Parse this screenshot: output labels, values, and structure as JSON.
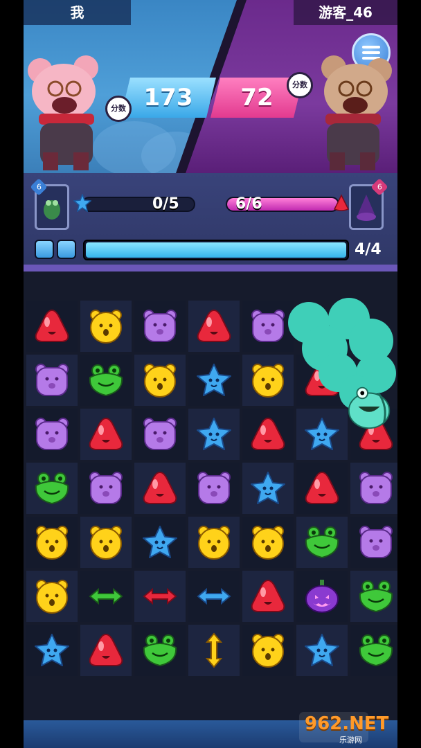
{
  "header": {
    "player_left_name": "我",
    "player_right_name": "游客_46",
    "score_left": "173",
    "score_right": "72",
    "score_badge_label": "分数"
  },
  "progress": {
    "left_card_count": "6",
    "right_card_count": "6",
    "left_goal_text": "0/5",
    "left_goal_fraction": 0.0,
    "right_goal_text": "6/6",
    "right_goal_fraction": 1.0,
    "moves_text": "4/4",
    "moves_fraction": 1.0
  },
  "board": {
    "rows": 7,
    "cols": 7,
    "grid": [
      [
        "red-drop",
        "yellow-bear",
        "purple-bear",
        "red-drop",
        "purple-bear",
        "goo",
        "goo"
      ],
      [
        "purple-bear",
        "green-frog",
        "yellow-bear",
        "blue-star",
        "yellow-bear",
        "red-drop",
        "goo"
      ],
      [
        "purple-bear",
        "red-drop",
        "purple-bear",
        "blue-star",
        "red-drop",
        "blue-star",
        "red-drop"
      ],
      [
        "green-frog",
        "purple-bear",
        "red-drop",
        "purple-bear",
        "blue-star",
        "red-drop",
        "purple-bear"
      ],
      [
        "yellow-bear",
        "yellow-bear",
        "blue-star",
        "yellow-bear",
        "yellow-bear",
        "green-frog",
        "purple-bear"
      ],
      [
        "yellow-bear",
        "green-arrow-h",
        "red-arrow-h",
        "blue-arrow-h",
        "red-drop",
        "purple-pumpkin",
        "green-frog"
      ],
      [
        "blue-star",
        "red-drop",
        "green-frog",
        "yellow-arrow-v",
        "yellow-bear",
        "blue-star",
        "green-frog"
      ]
    ]
  },
  "colors": {
    "red": "#e8283c",
    "yellow": "#ffd21a",
    "purple": "#b57ae8",
    "green": "#3fc83a",
    "blue": "#3fa8f0",
    "goo": "#3fcfb8"
  },
  "watermark": {
    "main": "962.NET",
    "sub": "乐游网"
  }
}
